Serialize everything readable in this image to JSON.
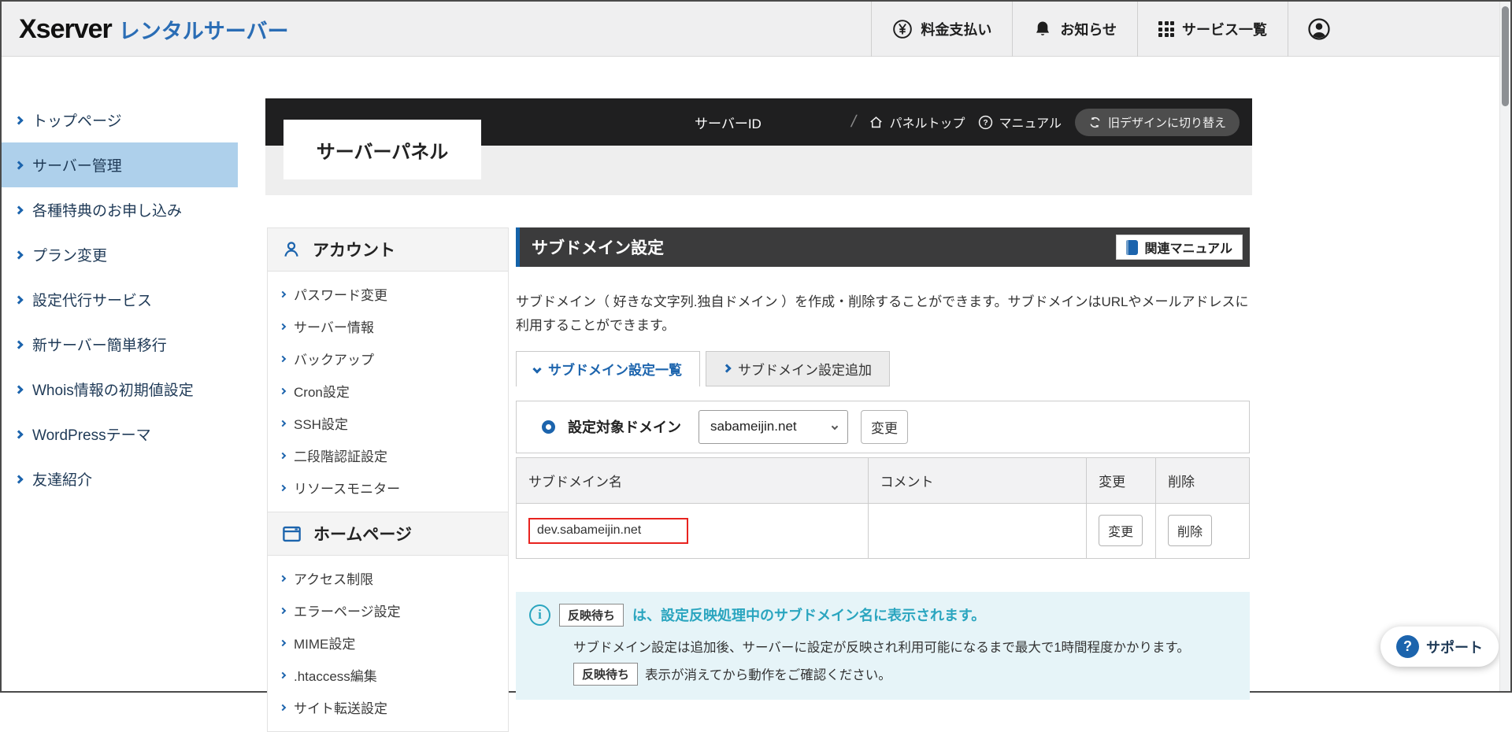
{
  "header": {
    "logo_brand": "Xserver",
    "logo_suffix": "レンタルサーバー",
    "menu": [
      {
        "label": "料金支払い"
      },
      {
        "label": "お知らせ"
      },
      {
        "label": "サービス一覧"
      }
    ]
  },
  "sidebar": {
    "items": [
      {
        "label": "トップページ",
        "selected": false
      },
      {
        "label": "サーバー管理",
        "selected": true
      },
      {
        "label": "各種特典のお申し込み",
        "selected": false
      },
      {
        "label": "プラン変更",
        "selected": false
      },
      {
        "label": "設定代行サービス",
        "selected": false
      },
      {
        "label": "新サーバー簡単移行",
        "selected": false
      },
      {
        "label": "Whois情報の初期値設定",
        "selected": false
      },
      {
        "label": "WordPressテーマ",
        "selected": false
      },
      {
        "label": "友達紹介",
        "selected": false
      }
    ]
  },
  "panel_header": {
    "logo": "サーバーパネル",
    "server_id_label": "サーバーID",
    "slash": "/",
    "panel_top": "パネルトップ",
    "manual": "マニュアル",
    "switch_design": "旧デザインに切り替え"
  },
  "panel_menu": {
    "sections": [
      {
        "title": "アカウント",
        "items": [
          "パスワード変更",
          "サーバー情報",
          "バックアップ",
          "Cron設定",
          "SSH設定",
          "二段階認証設定",
          "リソースモニター"
        ]
      },
      {
        "title": "ホームページ",
        "items": [
          "アクセス制限",
          "エラーページ設定",
          "MIME設定",
          ".htaccess編集",
          "サイト転送設定"
        ]
      }
    ]
  },
  "main": {
    "title": "サブドメイン設定",
    "manual_button": "関連マニュアル",
    "description": "サブドメイン（ 好きな文字列.独自ドメイン ）を作成・削除することができます。サブドメインはURLやメールアドレスに利用することができます。",
    "tabs": [
      {
        "label": "サブドメイン設定一覧",
        "active": true
      },
      {
        "label": "サブドメイン設定追加",
        "active": false
      }
    ],
    "domain_selector": {
      "label": "設定対象ドメイン",
      "value": "sabameijin.net",
      "change_button": "変更"
    },
    "table": {
      "headers": [
        "サブドメイン名",
        "コメント",
        "変更",
        "削除"
      ],
      "rows": [
        {
          "subdomain": "dev.sabameijin.net",
          "comment": "",
          "change": "変更",
          "delete": "削除"
        }
      ]
    },
    "info": {
      "badge": "反映待ち",
      "line1": "は、設定反映処理中のサブドメイン名に表示されます。",
      "line2": "サブドメイン設定は追加後、サーバーに設定が反映され利用可能になるまで最大で1時間程度かかります。",
      "line3": "表示が消えてから動作をご確認ください。"
    }
  },
  "support": {
    "label": "サポート"
  },
  "colors": {
    "accent_blue": "#1c64ad",
    "dark_bar": "#1f1f20",
    "selected_item_bg": "#aed0eb",
    "info_teal": "#2aa5bf",
    "info_bg": "#e6f4f8",
    "highlight_red": "#e8231f"
  }
}
